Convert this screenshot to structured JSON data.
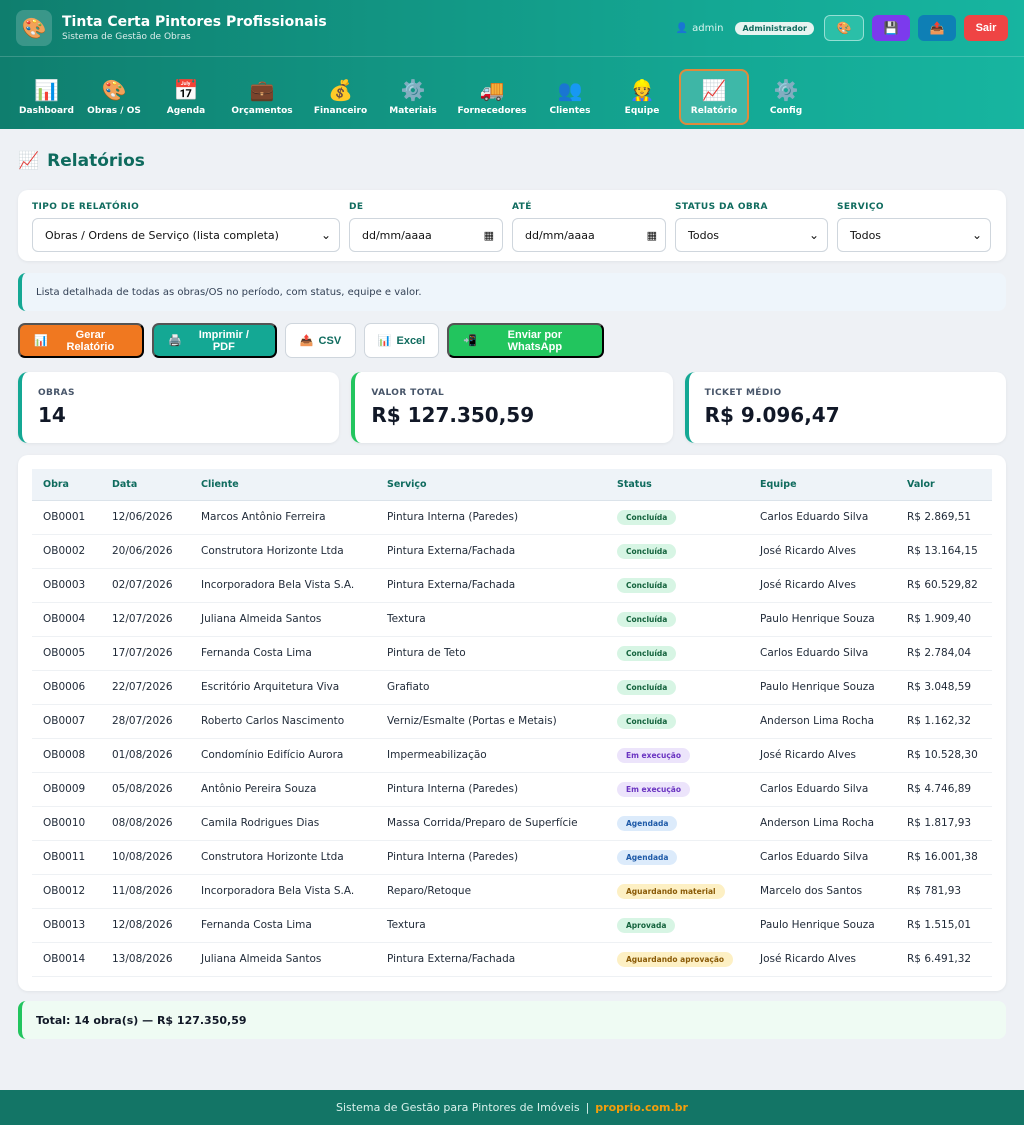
{
  "header": {
    "logo_icon": "🎨",
    "title": "Tinta Certa Pintores Profissionais",
    "subtitle": "Sistema de Gestão de Obras",
    "user_icon": "👤",
    "user": "admin",
    "role": "Administrador",
    "theme_icon": "🎨",
    "save_icon": "💾",
    "cloud_icon": "📤",
    "exit_label": "Sair"
  },
  "nav": [
    {
      "icon": "📊",
      "label": "Dashboard"
    },
    {
      "icon": "🎨",
      "label": "Obras / OS"
    },
    {
      "icon": "📅",
      "label": "Agenda"
    },
    {
      "icon": "💼",
      "label": "Orçamentos"
    },
    {
      "icon": "💰",
      "label": "Financeiro"
    },
    {
      "icon": "⚙️",
      "label": "Materiais"
    },
    {
      "icon": "🚚",
      "label": "Fornecedores"
    },
    {
      "icon": "👥",
      "label": "Clientes"
    },
    {
      "icon": "👷",
      "label": "Equipe"
    },
    {
      "icon": "📈",
      "label": "Relatório"
    },
    {
      "icon": "⚙️",
      "label": "Config"
    }
  ],
  "page": {
    "title_icon": "📈",
    "title": "Relatórios"
  },
  "filters": {
    "tipo_label": "TIPO DE RELATÓRIO",
    "tipo_value": "Obras / Ordens de Serviço (lista completa)",
    "de_label": "DE",
    "de_value": "dd/mm/aaaa",
    "ate_label": "ATÉ",
    "ate_value": "dd/mm/aaaa",
    "status_label": "STATUS DA OBRA",
    "status_value": "Todos",
    "servico_label": "SERVIÇO",
    "servico_value": "Todos"
  },
  "info_text": "Lista detalhada de todas as obras/OS no período, com status, equipe e valor.",
  "actions": {
    "gerar": "Gerar Relatório",
    "imprimir": "Imprimir / PDF",
    "csv": "CSV",
    "excel": "Excel",
    "whatsapp": "Enviar por WhatsApp",
    "gerar_icon": "📊",
    "imprimir_icon": "🖨️",
    "csv_icon": "📤",
    "excel_icon": "📊",
    "whatsapp_icon": "📲"
  },
  "stats": [
    {
      "label": "OBRAS",
      "value": "14"
    },
    {
      "label": "VALOR TOTAL",
      "value": "R$ 127.350,59"
    },
    {
      "label": "TICKET MÉDIO",
      "value": "R$ 9.096,47"
    }
  ],
  "table": {
    "headers": [
      "Obra",
      "Data",
      "Cliente",
      "Serviço",
      "Status",
      "Equipe",
      "Valor"
    ],
    "rows": [
      {
        "obra": "OB0001",
        "data": "12/06/2026",
        "cliente": "Marcos Antônio Ferreira",
        "servico": "Pintura Interna (Paredes)",
        "status": "Concluída",
        "status_type": "conc",
        "equipe": "Carlos Eduardo Silva",
        "valor": "R$ 2.869,51"
      },
      {
        "obra": "OB0002",
        "data": "20/06/2026",
        "cliente": "Construtora Horizonte Ltda",
        "servico": "Pintura Externa/Fachada",
        "status": "Concluída",
        "status_type": "conc",
        "equipe": "José Ricardo Alves",
        "valor": "R$ 13.164,15"
      },
      {
        "obra": "OB0003",
        "data": "02/07/2026",
        "cliente": "Incorporadora Bela Vista S.A.",
        "servico": "Pintura Externa/Fachada",
        "status": "Concluída",
        "status_type": "conc",
        "equipe": "José Ricardo Alves",
        "valor": "R$ 60.529,82"
      },
      {
        "obra": "OB0004",
        "data": "12/07/2026",
        "cliente": "Juliana Almeida Santos",
        "servico": "Textura",
        "status": "Concluída",
        "status_type": "conc",
        "equipe": "Paulo Henrique Souza",
        "valor": "R$ 1.909,40"
      },
      {
        "obra": "OB0005",
        "data": "17/07/2026",
        "cliente": "Fernanda Costa Lima",
        "servico": "Pintura de Teto",
        "status": "Concluída",
        "status_type": "conc",
        "equipe": "Carlos Eduardo Silva",
        "valor": "R$ 2.784,04"
      },
      {
        "obra": "OB0006",
        "data": "22/07/2026",
        "cliente": "Escritório Arquitetura Viva",
        "servico": "Grafiato",
        "status": "Concluída",
        "status_type": "conc",
        "equipe": "Paulo Henrique Souza",
        "valor": "R$ 3.048,59"
      },
      {
        "obra": "OB0007",
        "data": "28/07/2026",
        "cliente": "Roberto Carlos Nascimento",
        "servico": "Verniz/Esmalte (Portas e Metais)",
        "status": "Concluída",
        "status_type": "conc",
        "equipe": "Anderson Lima Rocha",
        "valor": "R$ 1.162,32"
      },
      {
        "obra": "OB0008",
        "data": "01/08/2026",
        "cliente": "Condomínio Edifício Aurora",
        "servico": "Impermeabilização",
        "status": "Em execução",
        "status_type": "exec",
        "equipe": "José Ricardo Alves",
        "valor": "R$ 10.528,30"
      },
      {
        "obra": "OB0009",
        "data": "05/08/2026",
        "cliente": "Antônio Pereira Souza",
        "servico": "Pintura Interna (Paredes)",
        "status": "Em execução",
        "status_type": "exec",
        "equipe": "Carlos Eduardo Silva",
        "valor": "R$ 4.746,89"
      },
      {
        "obra": "OB0010",
        "data": "08/08/2026",
        "cliente": "Camila Rodrigues Dias",
        "servico": "Massa Corrida/Preparo de Superfície",
        "status": "Agendada",
        "status_type": "agen",
        "equipe": "Anderson Lima Rocha",
        "valor": "R$ 1.817,93"
      },
      {
        "obra": "OB0011",
        "data": "10/08/2026",
        "cliente": "Construtora Horizonte Ltda",
        "servico": "Pintura Interna (Paredes)",
        "status": "Agendada",
        "status_type": "agen",
        "equipe": "Carlos Eduardo Silva",
        "valor": "R$ 16.001,38"
      },
      {
        "obra": "OB0012",
        "data": "11/08/2026",
        "cliente": "Incorporadora Bela Vista S.A.",
        "servico": "Reparo/Retoque",
        "status": "Aguardando material",
        "status_type": "aguard",
        "equipe": "Marcelo dos Santos",
        "valor": "R$ 781,93"
      },
      {
        "obra": "OB0013",
        "data": "12/08/2026",
        "cliente": "Fernanda Costa Lima",
        "servico": "Textura",
        "status": "Aprovada",
        "status_type": "apr",
        "equipe": "Paulo Henrique Souza",
        "valor": "R$ 1.515,01"
      },
      {
        "obra": "OB0014",
        "data": "13/08/2026",
        "cliente": "Juliana Almeida Santos",
        "servico": "Pintura Externa/Fachada",
        "status": "Aguardando aprovação",
        "status_type": "aguard",
        "equipe": "José Ricardo Alves",
        "valor": "R$ 6.491,32"
      }
    ]
  },
  "total_text": "Total: 14 obra(s) — R$ 127.350,59",
  "footer": {
    "text": "Sistema de Gestão para Pintores de Imóveis",
    "sep": "|",
    "site": "proprio.com.br"
  },
  "colors": {
    "primary": "#14a894",
    "primary_dark": "#0f6b5e",
    "orange": "#f07820",
    "green": "#22c55e",
    "purple": "#7c3aed",
    "red": "#ef4444"
  }
}
